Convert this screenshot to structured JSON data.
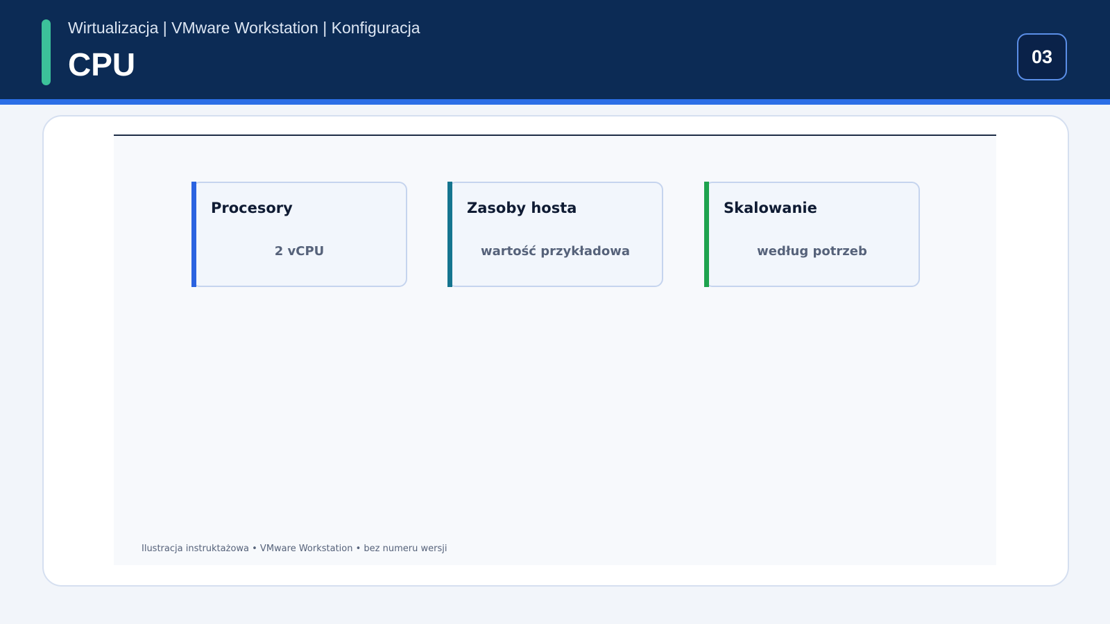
{
  "header": {
    "breadcrumb": "Wirtualizacja | VMware Workstation | Konfiguracja",
    "title": "CPU",
    "slide_number": "03"
  },
  "cards": [
    {
      "title": "Procesory",
      "value": "2 vCPU",
      "accent_color": "#2b63e0"
    },
    {
      "title": "Zasoby hosta",
      "value": "wartość przykładowa",
      "accent_color": "#15758f"
    },
    {
      "title": "Skalowanie",
      "value": "według potrzeb",
      "accent_color": "#1ea34e"
    }
  ],
  "footnote": "Ilustracja instruktażowa • VMware Workstation • bez numeru wersji",
  "colors": {
    "header_bg": "#0c2b55",
    "header_rule": "#2b6ee6",
    "accent_pill": "#3cc29a"
  }
}
